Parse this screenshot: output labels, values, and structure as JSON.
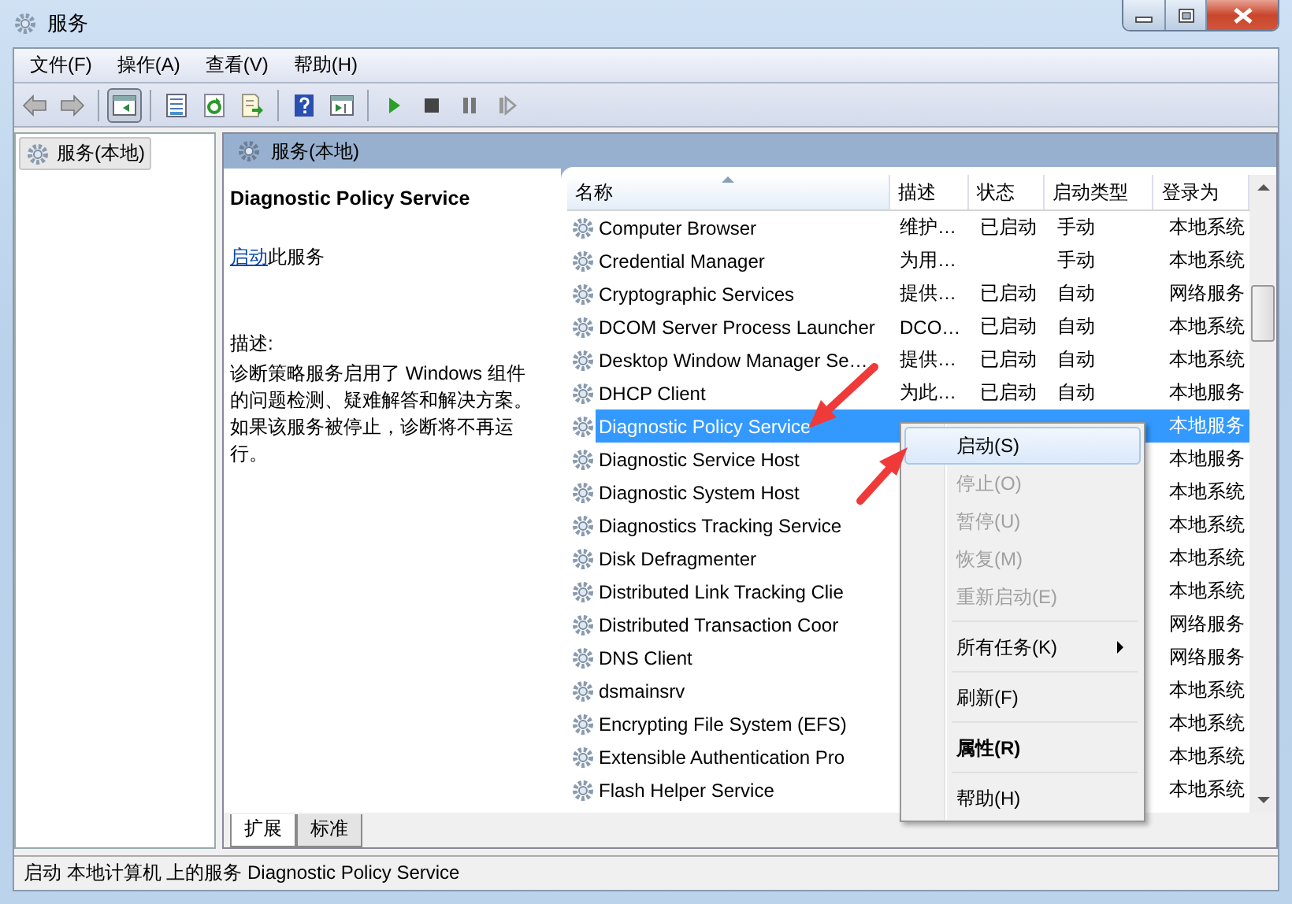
{
  "window": {
    "title": "服务"
  },
  "menu_bar": [
    "文件(F)",
    "操作(A)",
    "查看(V)",
    "帮助(H)"
  ],
  "toolbar": [
    {
      "kind": "back",
      "disabled": true
    },
    {
      "kind": "forward",
      "disabled": true
    },
    {
      "kind": "separator"
    },
    {
      "kind": "console-tree",
      "pressed": true
    },
    {
      "kind": "separator"
    },
    {
      "kind": "properties",
      "pressed": false
    },
    {
      "kind": "refresh",
      "pressed": false
    },
    {
      "kind": "export",
      "pressed": false
    },
    {
      "kind": "separator"
    },
    {
      "kind": "help",
      "pressed": false
    },
    {
      "kind": "action-pane",
      "pressed": false
    },
    {
      "kind": "separator"
    },
    {
      "kind": "play",
      "pressed": false
    },
    {
      "kind": "stop",
      "pressed": false
    },
    {
      "kind": "pause",
      "pressed": false
    },
    {
      "kind": "resume",
      "disabled": true
    }
  ],
  "tree": {
    "items": [
      {
        "label": "服务(本地)",
        "selected": true
      }
    ]
  },
  "pane_header": "服务(本地)",
  "details": {
    "title": "Diagnostic Policy Service",
    "action_link": "启动",
    "action_text": "此服务",
    "description_label": "描述:",
    "description": "诊断策略服务启用了 Windows 组件的问题检测、疑难解答和解决方案。如果该服务被停止，诊断将不再运行。"
  },
  "table": {
    "columns": [
      {
        "label": "名称",
        "sorted": true
      },
      {
        "label": "描述",
        "sorted": false
      },
      {
        "label": "状态",
        "sorted": false
      },
      {
        "label": "启动类型",
        "sorted": false
      },
      {
        "label": "登录为",
        "sorted": false
      }
    ],
    "rows": [
      {
        "name": "Computer Browser",
        "description": "维护…",
        "status": "已启动",
        "startup": "手动",
        "logon": "本地系统",
        "selected": false
      },
      {
        "name": "Credential Manager",
        "description": "为用…",
        "startup": "手动",
        "logon": "本地系统",
        "selected": false
      },
      {
        "name": "Cryptographic Services",
        "description": "提供…",
        "status": "已启动",
        "startup": "自动",
        "logon": "网络服务",
        "selected": false
      },
      {
        "name": "DCOM Server Process Launcher",
        "description": "DCO…",
        "status": "已启动",
        "startup": "自动",
        "logon": "本地系统",
        "selected": false
      },
      {
        "name": "Desktop Window Manager Se…",
        "description": "提供…",
        "status": "已启动",
        "startup": "自动",
        "logon": "本地系统",
        "selected": false
      },
      {
        "name": "DHCP Client",
        "description": "为此…",
        "status": "已启动",
        "startup": "自动",
        "logon": "本地服务",
        "selected": false
      },
      {
        "name": "Diagnostic Policy Service",
        "logon": "本地服务",
        "selected": true
      },
      {
        "name": "Diagnostic Service Host",
        "logon": "本地服务",
        "selected": false
      },
      {
        "name": "Diagnostic System Host",
        "logon": "本地系统",
        "selected": false
      },
      {
        "name": "Diagnostics Tracking Service",
        "logon": "本地系统",
        "selected": false
      },
      {
        "name": "Disk Defragmenter",
        "logon": "本地系统",
        "selected": false
      },
      {
        "name": "Distributed Link Tracking Clie",
        "logon": "本地系统",
        "selected": false
      },
      {
        "name": "Distributed Transaction Coor",
        "logon": "网络服务",
        "selected": false
      },
      {
        "name": "DNS Client",
        "logon": "网络服务",
        "selected": false
      },
      {
        "name": "dsmainsrv",
        "logon": "本地系统",
        "selected": false
      },
      {
        "name": "Encrypting File System (EFS)",
        "logon": "本地系统",
        "selected": false
      },
      {
        "name": "Extensible Authentication Pro",
        "logon": "本地系统",
        "selected": false
      },
      {
        "name": "Flash Helper Service",
        "logon": "本地系统",
        "selected": false
      }
    ]
  },
  "context_menu": [
    {
      "kind": "item",
      "label": "启动(S)",
      "selected": true,
      "disabled": false
    },
    {
      "kind": "item",
      "label": "停止(O)",
      "selected": false,
      "disabled": true
    },
    {
      "kind": "item",
      "label": "暂停(U)",
      "selected": false,
      "disabled": true
    },
    {
      "kind": "item",
      "label": "恢复(M)",
      "selected": false,
      "disabled": true
    },
    {
      "kind": "item",
      "label": "重新启动(E)",
      "selected": false,
      "disabled": true
    },
    {
      "kind": "separator"
    },
    {
      "kind": "item",
      "label": "所有任务(K)",
      "selected": false,
      "disabled": false,
      "submenu": true
    },
    {
      "kind": "separator"
    },
    {
      "kind": "item",
      "label": "刷新(F)",
      "selected": false,
      "disabled": false
    },
    {
      "kind": "separator"
    },
    {
      "kind": "item",
      "label": "属性(R)",
      "selected": false,
      "disabled": false,
      "bold": true
    },
    {
      "kind": "separator"
    },
    {
      "kind": "item",
      "label": "帮助(H)",
      "selected": false,
      "disabled": false
    }
  ],
  "view_tabs": [
    {
      "label": "扩展",
      "selected": true
    },
    {
      "label": "标准",
      "selected": false
    }
  ],
  "status_bar": "启动 本地计算机 上的服务 Diagnostic Policy Service",
  "annotations": [
    {
      "kind": "arrow"
    },
    {
      "kind": "arrow"
    }
  ]
}
